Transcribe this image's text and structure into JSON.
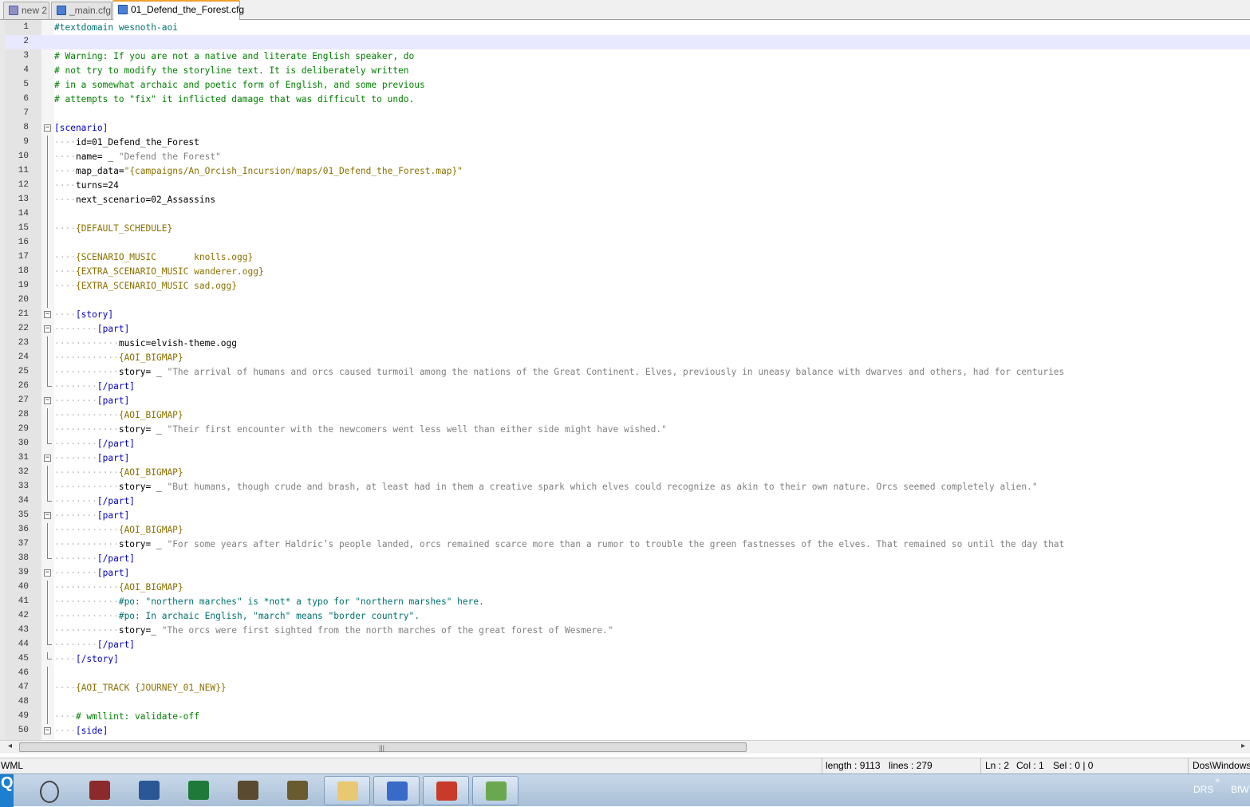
{
  "tabs": [
    {
      "label": "new 2",
      "icon": "floppy-disk-icon"
    },
    {
      "label": "_main.cfg",
      "icon": "floppy-disk-icon"
    },
    {
      "label": "01_Defend_the_Forest.cfg",
      "icon": "floppy-disk-icon",
      "active": true
    }
  ],
  "editor": {
    "current_line": 2,
    "lines": [
      {
        "n": "1",
        "indent": 0,
        "text": "#textdomain wesnoth-aoi",
        "cls": "c-po"
      },
      {
        "n": "2",
        "indent": 0,
        "text": "",
        "cls": ""
      },
      {
        "n": "3",
        "indent": 0,
        "text": "# Warning: If you are not a native and literate English speaker, do",
        "cls": "c-cmt"
      },
      {
        "n": "4",
        "indent": 0,
        "text": "# not try to modify the storyline text. It is deliberately written",
        "cls": "c-cmt"
      },
      {
        "n": "5",
        "indent": 0,
        "text": "# in a somewhat archaic and poetic form of English, and some previous",
        "cls": "c-cmt"
      },
      {
        "n": "6",
        "indent": 0,
        "text": "# attempts to \"fix\" it inflicted damage that was difficult to undo.",
        "cls": "c-cmt"
      },
      {
        "n": "7",
        "indent": 0,
        "text": "",
        "cls": ""
      },
      {
        "n": "8",
        "indent": 0,
        "text": "[scenario]",
        "cls": "c-tag",
        "fold": "open"
      },
      {
        "n": "9",
        "indent": 1,
        "text": "id=01_Defend_the_Forest",
        "cls": "c-key",
        "fold": "line"
      },
      {
        "n": "10",
        "indent": 1,
        "text": "name= _ ",
        "cls": "c-key",
        "rest": "\"Defend the Forest\"",
        "restcls": "c-str",
        "fold": "line"
      },
      {
        "n": "11",
        "indent": 1,
        "text": "map_data=",
        "cls": "c-key",
        "rest": "\"{campaigns/An_Orcish_Incursion/maps/01_Defend_the_Forest.map}\"",
        "restcls": "c-macro",
        "fold": "line"
      },
      {
        "n": "12",
        "indent": 1,
        "text": "turns=24",
        "cls": "c-key",
        "fold": "line"
      },
      {
        "n": "13",
        "indent": 1,
        "text": "next_scenario=02_Assassins",
        "cls": "c-key",
        "fold": "line"
      },
      {
        "n": "14",
        "indent": 0,
        "text": "",
        "cls": "",
        "fold": "line"
      },
      {
        "n": "15",
        "indent": 1,
        "text": "{DEFAULT_SCHEDULE}",
        "cls": "c-macro",
        "fold": "line"
      },
      {
        "n": "16",
        "indent": 0,
        "text": "",
        "cls": "",
        "fold": "line"
      },
      {
        "n": "17",
        "indent": 1,
        "text": "{SCENARIO_MUSIC       knolls.ogg}",
        "cls": "c-macro",
        "fold": "line"
      },
      {
        "n": "18",
        "indent": 1,
        "text": "{EXTRA_SCENARIO_MUSIC wanderer.ogg}",
        "cls": "c-macro",
        "fold": "line"
      },
      {
        "n": "19",
        "indent": 1,
        "text": "{EXTRA_SCENARIO_MUSIC sad.ogg}",
        "cls": "c-macro",
        "fold": "line"
      },
      {
        "n": "20",
        "indent": 0,
        "text": "",
        "cls": "",
        "fold": "line"
      },
      {
        "n": "21",
        "indent": 1,
        "text": "[story]",
        "cls": "c-tag",
        "fold": "open"
      },
      {
        "n": "22",
        "indent": 2,
        "text": "[part]",
        "cls": "c-tag",
        "fold": "open"
      },
      {
        "n": "23",
        "indent": 3,
        "text": "music=elvish-theme.ogg",
        "cls": "c-key",
        "fold": "line"
      },
      {
        "n": "24",
        "indent": 3,
        "text": "{AOI_BIGMAP}",
        "cls": "c-macro",
        "fold": "line"
      },
      {
        "n": "25",
        "indent": 3,
        "text": "story= _ ",
        "cls": "c-key",
        "rest": "\"The arrival of humans and orcs caused turmoil among the nations of the Great Continent. Elves, previously in uneasy balance with dwarves and others, had for centuries",
        "restcls": "c-str",
        "fold": "line"
      },
      {
        "n": "26",
        "indent": 2,
        "text": "[/part]",
        "cls": "c-tag",
        "fold": "end"
      },
      {
        "n": "27",
        "indent": 2,
        "text": "[part]",
        "cls": "c-tag",
        "fold": "open"
      },
      {
        "n": "28",
        "indent": 3,
        "text": "{AOI_BIGMAP}",
        "cls": "c-macro",
        "fold": "line"
      },
      {
        "n": "29",
        "indent": 3,
        "text": "story= _ ",
        "cls": "c-key",
        "rest": "\"Their first encounter with the newcomers went less well than either side might have wished.\"",
        "restcls": "c-str",
        "fold": "line"
      },
      {
        "n": "30",
        "indent": 2,
        "text": "[/part]",
        "cls": "c-tag",
        "fold": "end"
      },
      {
        "n": "31",
        "indent": 2,
        "text": "[part]",
        "cls": "c-tag",
        "fold": "open"
      },
      {
        "n": "32",
        "indent": 3,
        "text": "{AOI_BIGMAP}",
        "cls": "c-macro",
        "fold": "line"
      },
      {
        "n": "33",
        "indent": 3,
        "text": "story= _ ",
        "cls": "c-key",
        "rest": "\"But humans, though crude and brash, at least had in them a creative spark which elves could recognize as akin to their own nature. Orcs seemed completely alien.\"",
        "restcls": "c-str",
        "fold": "line"
      },
      {
        "n": "34",
        "indent": 2,
        "text": "[/part]",
        "cls": "c-tag",
        "fold": "end"
      },
      {
        "n": "35",
        "indent": 2,
        "text": "[part]",
        "cls": "c-tag",
        "fold": "open"
      },
      {
        "n": "36",
        "indent": 3,
        "text": "{AOI_BIGMAP}",
        "cls": "c-macro",
        "fold": "line"
      },
      {
        "n": "37",
        "indent": 3,
        "text": "story= _ ",
        "cls": "c-key",
        "rest": "\"For some years after Haldric’s people landed, orcs remained scarce more than a rumor to trouble the green fastnesses of the elves. That remained so until the day that",
        "restcls": "c-str",
        "fold": "line"
      },
      {
        "n": "38",
        "indent": 2,
        "text": "[/part]",
        "cls": "c-tag",
        "fold": "end"
      },
      {
        "n": "39",
        "indent": 2,
        "text": "[part]",
        "cls": "c-tag",
        "fold": "open"
      },
      {
        "n": "40",
        "indent": 3,
        "text": "{AOI_BIGMAP}",
        "cls": "c-macro",
        "fold": "line"
      },
      {
        "n": "41",
        "indent": 3,
        "text": "#po: \"northern marches\" is *not* a typo for \"northern marshes\" here.",
        "cls": "c-po",
        "fold": "line"
      },
      {
        "n": "42",
        "indent": 3,
        "text": "#po: In archaic English, \"march\" means \"border country\".",
        "cls": "c-po",
        "fold": "line"
      },
      {
        "n": "43",
        "indent": 3,
        "text": "story=_ ",
        "cls": "c-key",
        "rest": "\"The orcs were first sighted from the north marches of the great forest of Wesmere.\"",
        "restcls": "c-str",
        "fold": "line"
      },
      {
        "n": "44",
        "indent": 2,
        "text": "[/part]",
        "cls": "c-tag",
        "fold": "end"
      },
      {
        "n": "45",
        "indent": 1,
        "text": "[/story]",
        "cls": "c-tag",
        "fold": "end"
      },
      {
        "n": "46",
        "indent": 0,
        "text": "",
        "cls": "",
        "fold": "line"
      },
      {
        "n": "47",
        "indent": 1,
        "text": "{AOI_TRACK {JOURNEY_01_NEW}}",
        "cls": "c-macro",
        "fold": "line"
      },
      {
        "n": "48",
        "indent": 0,
        "text": "",
        "cls": "",
        "fold": "line"
      },
      {
        "n": "49",
        "indent": 1,
        "text": "# wmllint: validate-off",
        "cls": "c-cmt",
        "fold": "line"
      },
      {
        "n": "50",
        "indent": 1,
        "text": "[side]",
        "cls": "c-tag",
        "fold": "open"
      }
    ]
  },
  "statusbar": {
    "language": "WML",
    "length": "length : 9113",
    "lines": "lines : 279",
    "ln": "Ln : 2",
    "col": "Col : 1",
    "sel": "Sel : 0 | 0",
    "eol": "Dos\\Windows"
  },
  "taskbar": {
    "start_label": "Q",
    "apps": [
      {
        "icon": "alien-app-icon",
        "color": "#ffffff"
      },
      {
        "icon": "book-app-icon",
        "color": "#8b2a2a"
      },
      {
        "icon": "word-icon",
        "color": "#2b5797"
      },
      {
        "icon": "excel-icon",
        "color": "#1f7a3a"
      },
      {
        "icon": "wesnoth-shield-icon",
        "color": "#5a4a30"
      },
      {
        "icon": "wesnoth-shield-icon",
        "color": "#6a5a30"
      },
      {
        "icon": "file-explorer-icon",
        "color": "#e8c870"
      },
      {
        "icon": "remote-desktop-icon",
        "color": "#3a6ac8"
      },
      {
        "icon": "package-app-icon",
        "color": "#c83a2a"
      },
      {
        "icon": "notepad-plus-plus-icon",
        "color": "#6aa84f"
      }
    ],
    "tray_expand": "»",
    "tray": [
      "DRS",
      "BfW"
    ]
  }
}
